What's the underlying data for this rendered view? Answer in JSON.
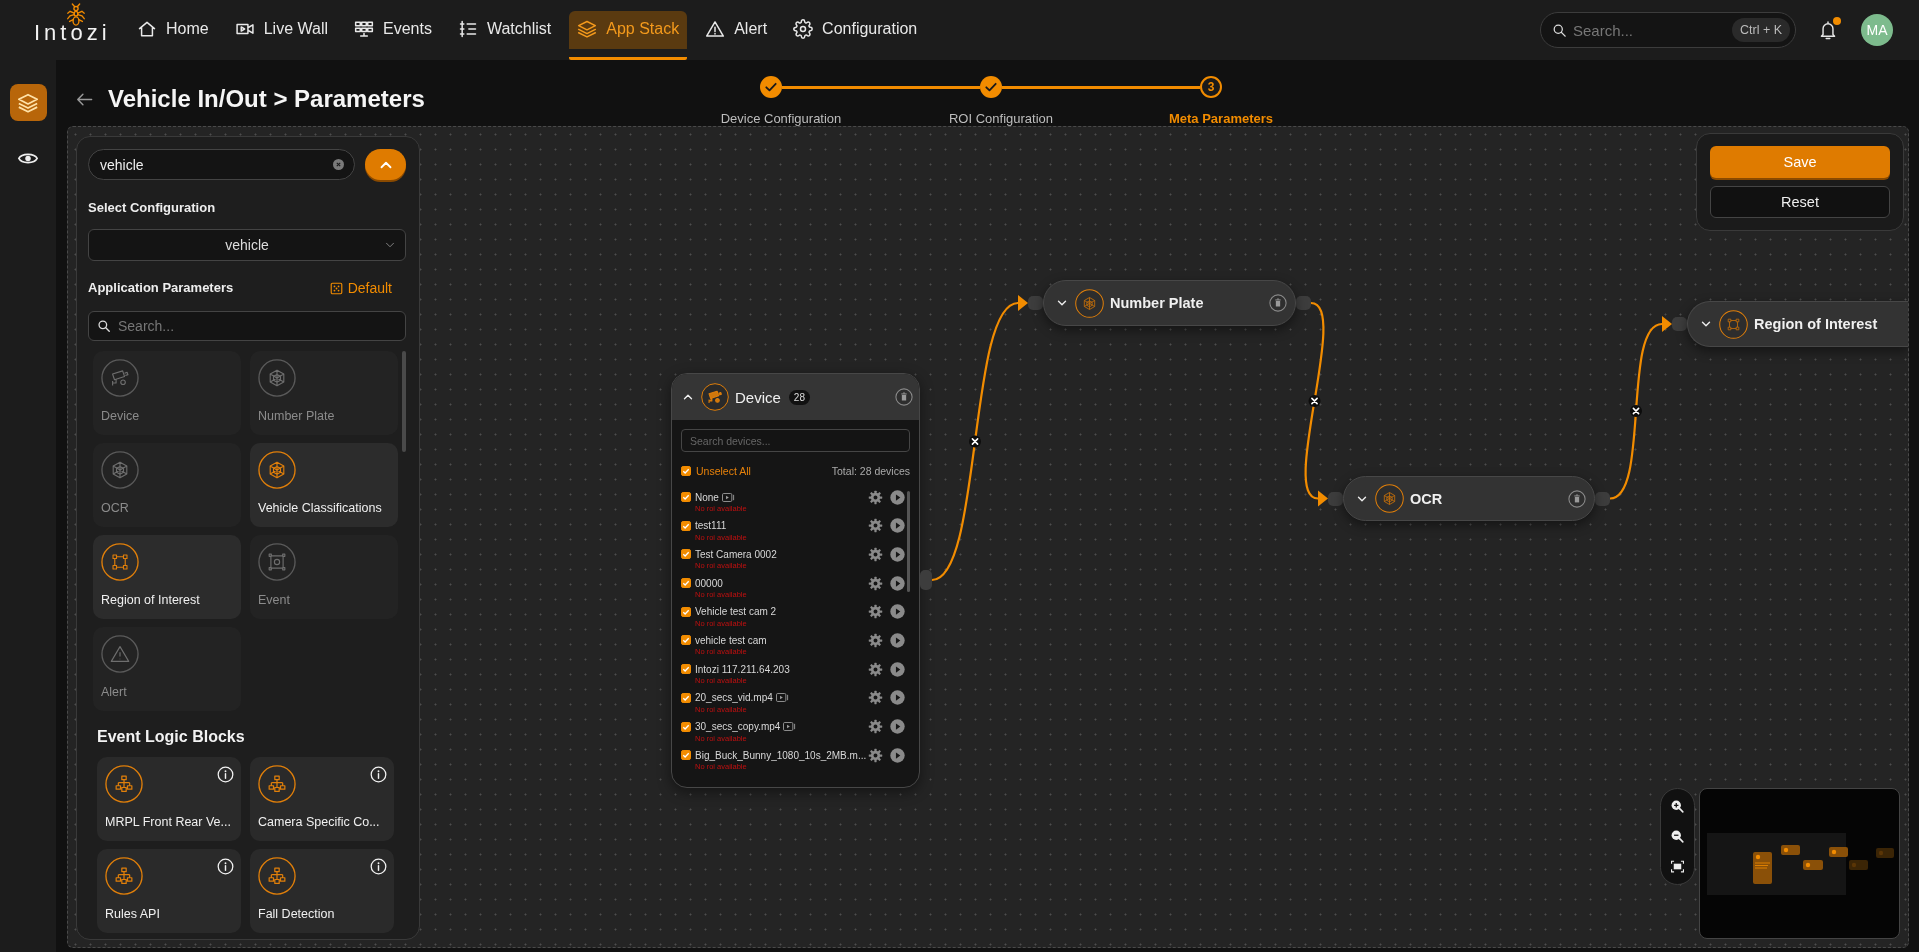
{
  "header": {
    "logo": "Intozi",
    "nav": [
      {
        "label": "Home",
        "selected": false
      },
      {
        "label": "Live Wall",
        "selected": false
      },
      {
        "label": "Events",
        "selected": false
      },
      {
        "label": "Watchlist",
        "selected": false
      },
      {
        "label": "App Stack",
        "selected": true
      },
      {
        "label": "Alert",
        "selected": false
      },
      {
        "label": "Configuration",
        "selected": false
      }
    ],
    "search": {
      "placeholder": "Search...",
      "shortcut": "Ctrl + K"
    },
    "notifications": {
      "unread": true
    },
    "avatar": {
      "initials": "MA"
    }
  },
  "rail": [
    {
      "selected": true
    },
    {
      "selected": false
    }
  ],
  "page": {
    "title": "Vehicle In/Out > Parameters"
  },
  "stepper": [
    {
      "label": "Device Configuration",
      "done": true,
      "selected": false
    },
    {
      "label": "ROI Configuration",
      "done": true,
      "selected": false
    },
    {
      "label": "Meta Parameters",
      "number": "3",
      "done": false,
      "selected": true
    }
  ],
  "left_panel": {
    "search": {
      "value": "vehicle"
    },
    "config_label": "Select Configuration",
    "config_value": "vehicle",
    "params_title": "Application Parameters",
    "default_label": "Default",
    "params_search": {
      "placeholder": "Search..."
    },
    "parameters": [
      {
        "label": "Device",
        "disabled": true
      },
      {
        "label": "Number Plate",
        "disabled": true
      },
      {
        "label": "OCR",
        "disabled": true
      },
      {
        "label": "Vehicle Classifications",
        "disabled": false
      },
      {
        "label": "Region of Interest",
        "disabled": false
      },
      {
        "label": "Event",
        "disabled": true
      },
      {
        "label": "Alert",
        "disabled": true
      }
    ],
    "logic_title": "Event Logic Blocks",
    "logic_blocks": [
      {
        "label": "MRPL Front Rear Ve..."
      },
      {
        "label": "Camera Specific Co..."
      },
      {
        "label": "Rules API"
      },
      {
        "label": "Fall Detection"
      }
    ]
  },
  "canvas": {
    "device_node": {
      "title": "Device",
      "count": "28",
      "expanded": true,
      "search_placeholder": "Search devices...",
      "select_all": {
        "label": "Unselect All",
        "checked": true
      },
      "total": "Total: 28 devices",
      "devices": [
        {
          "name": "None",
          "video": true,
          "checked": true,
          "note": "No roi available"
        },
        {
          "name": "test111",
          "video": false,
          "checked": true,
          "note": "No roi available"
        },
        {
          "name": "Test Camera 0002",
          "video": false,
          "checked": true,
          "note": "No roi available"
        },
        {
          "name": "00000",
          "video": false,
          "checked": true,
          "note": "No roi available"
        },
        {
          "name": "Vehicle test cam 2",
          "video": false,
          "checked": true,
          "note": "No roi available"
        },
        {
          "name": "vehicle test cam",
          "video": false,
          "checked": true,
          "note": "No roi available"
        },
        {
          "name": "Intozi 117.211.64.203",
          "video": false,
          "checked": true,
          "note": "No roi available"
        },
        {
          "name": "20_secs_vid.mp4",
          "video": true,
          "checked": true,
          "note": "No roi available"
        },
        {
          "name": "30_secs_copy.mp4",
          "video": true,
          "checked": true,
          "note": "No roi available"
        },
        {
          "name": "Big_Buck_Bunny_1080_10s_2MB.m...",
          "video": false,
          "checked": true,
          "note": "No roi available"
        }
      ]
    },
    "nodes": [
      {
        "title": "Number Plate",
        "expanded": false,
        "deletable": true
      },
      {
        "title": "OCR",
        "expanded": false,
        "deletable": true
      },
      {
        "title": "Region of Interest",
        "expanded": false,
        "deletable": false
      }
    ],
    "actions": {
      "save": "Save",
      "reset": "Reset"
    }
  }
}
